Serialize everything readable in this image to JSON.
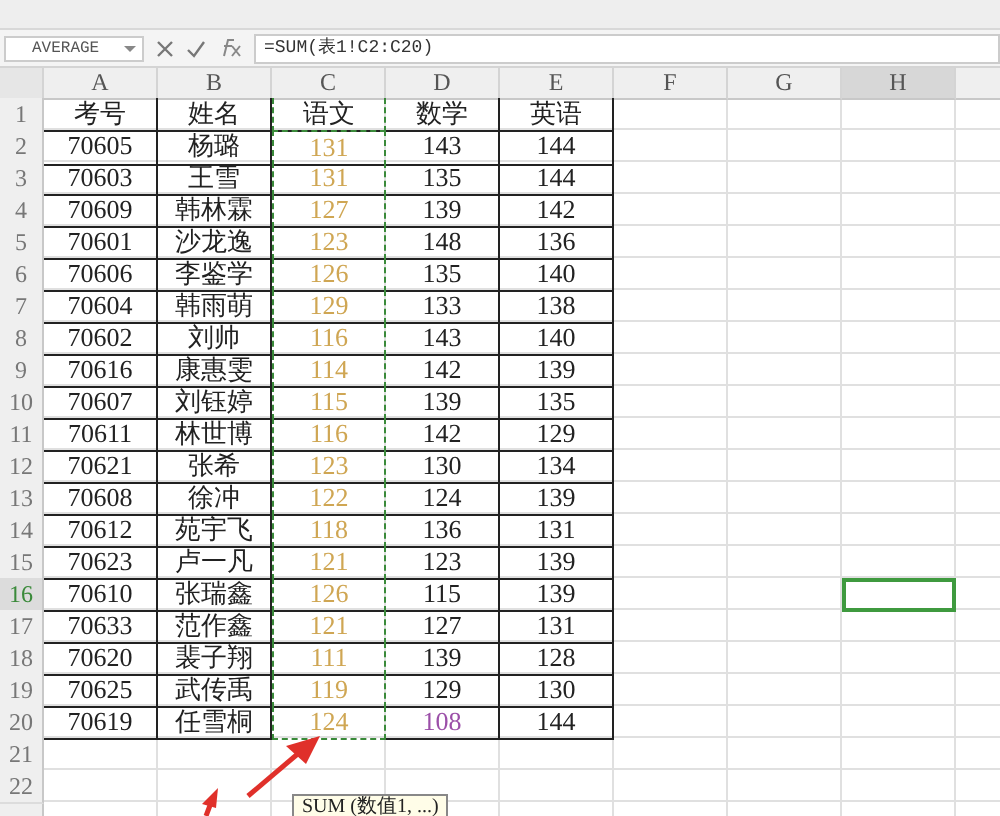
{
  "name_box": "AVERAGE",
  "formula": "=SUM(表1!C2:C20)",
  "columns": [
    {
      "letter": "A",
      "referenced": false,
      "selected": false
    },
    {
      "letter": "B",
      "referenced": false,
      "selected": false
    },
    {
      "letter": "C",
      "referenced": true,
      "selected": false
    },
    {
      "letter": "D",
      "referenced": false,
      "selected": false
    },
    {
      "letter": "E",
      "referenced": false,
      "selected": false
    },
    {
      "letter": "F",
      "referenced": false,
      "selected": false
    },
    {
      "letter": "G",
      "referenced": false,
      "selected": false
    },
    {
      "letter": "H",
      "referenced": false,
      "selected": true
    }
  ],
  "rows": [
    {
      "number": "1",
      "selected": false,
      "cells": [
        "考号",
        "姓名",
        "语文",
        "数学",
        "英语"
      ]
    },
    {
      "number": "2",
      "selected": false,
      "cells": [
        "70605",
        "杨璐",
        "131",
        "143",
        "144"
      ]
    },
    {
      "number": "3",
      "selected": false,
      "cells": [
        "70603",
        "王雪",
        "131",
        "135",
        "144"
      ]
    },
    {
      "number": "4",
      "selected": false,
      "cells": [
        "70609",
        "韩林霖",
        "127",
        "139",
        "142"
      ]
    },
    {
      "number": "5",
      "selected": false,
      "cells": [
        "70601",
        "沙龙逸",
        "123",
        "148",
        "136"
      ]
    },
    {
      "number": "6",
      "selected": false,
      "cells": [
        "70606",
        "李鉴学",
        "126",
        "135",
        "140"
      ]
    },
    {
      "number": "7",
      "selected": false,
      "cells": [
        "70604",
        "韩雨萌",
        "129",
        "133",
        "138"
      ]
    },
    {
      "number": "8",
      "selected": false,
      "cells": [
        "70602",
        "刘帅",
        "116",
        "143",
        "140"
      ]
    },
    {
      "number": "9",
      "selected": false,
      "cells": [
        "70616",
        "康惠雯",
        "114",
        "142",
        "139"
      ]
    },
    {
      "number": "10",
      "selected": false,
      "cells": [
        "70607",
        "刘钰婷",
        "115",
        "139",
        "135"
      ]
    },
    {
      "number": "11",
      "selected": false,
      "cells": [
        "70611",
        "林世博",
        "116",
        "142",
        "129"
      ]
    },
    {
      "number": "12",
      "selected": false,
      "cells": [
        "70621",
        "张希",
        "123",
        "130",
        "134"
      ]
    },
    {
      "number": "13",
      "selected": false,
      "cells": [
        "70608",
        "徐冲",
        "122",
        "124",
        "139"
      ]
    },
    {
      "number": "14",
      "selected": false,
      "cells": [
        "70612",
        "苑宇飞",
        "118",
        "136",
        "131"
      ]
    },
    {
      "number": "15",
      "selected": false,
      "cells": [
        "70623",
        "卢一凡",
        "121",
        "123",
        "139"
      ]
    },
    {
      "number": "16",
      "selected": true,
      "cells": [
        "70610",
        "张瑞鑫",
        "126",
        "115",
        "139"
      ]
    },
    {
      "number": "17",
      "selected": false,
      "cells": [
        "70633",
        "范作鑫",
        "121",
        "127",
        "131"
      ]
    },
    {
      "number": "18",
      "selected": false,
      "cells": [
        "70620",
        "裴子翔",
        "111",
        "139",
        "128"
      ]
    },
    {
      "number": "19",
      "selected": false,
      "cells": [
        "70625",
        "武传禹",
        "119",
        "129",
        "130"
      ]
    },
    {
      "number": "20",
      "selected": false,
      "cells": [
        "70619",
        "任雪桐",
        "124",
        {
          "text": "108",
          "color": "#9b4fa8"
        },
        "144"
      ]
    },
    {
      "number": "21",
      "selected": false,
      "cells": []
    },
    {
      "number": "22",
      "selected": false,
      "cells": []
    }
  ],
  "tooltip": "SUM (数值1, ...)"
}
